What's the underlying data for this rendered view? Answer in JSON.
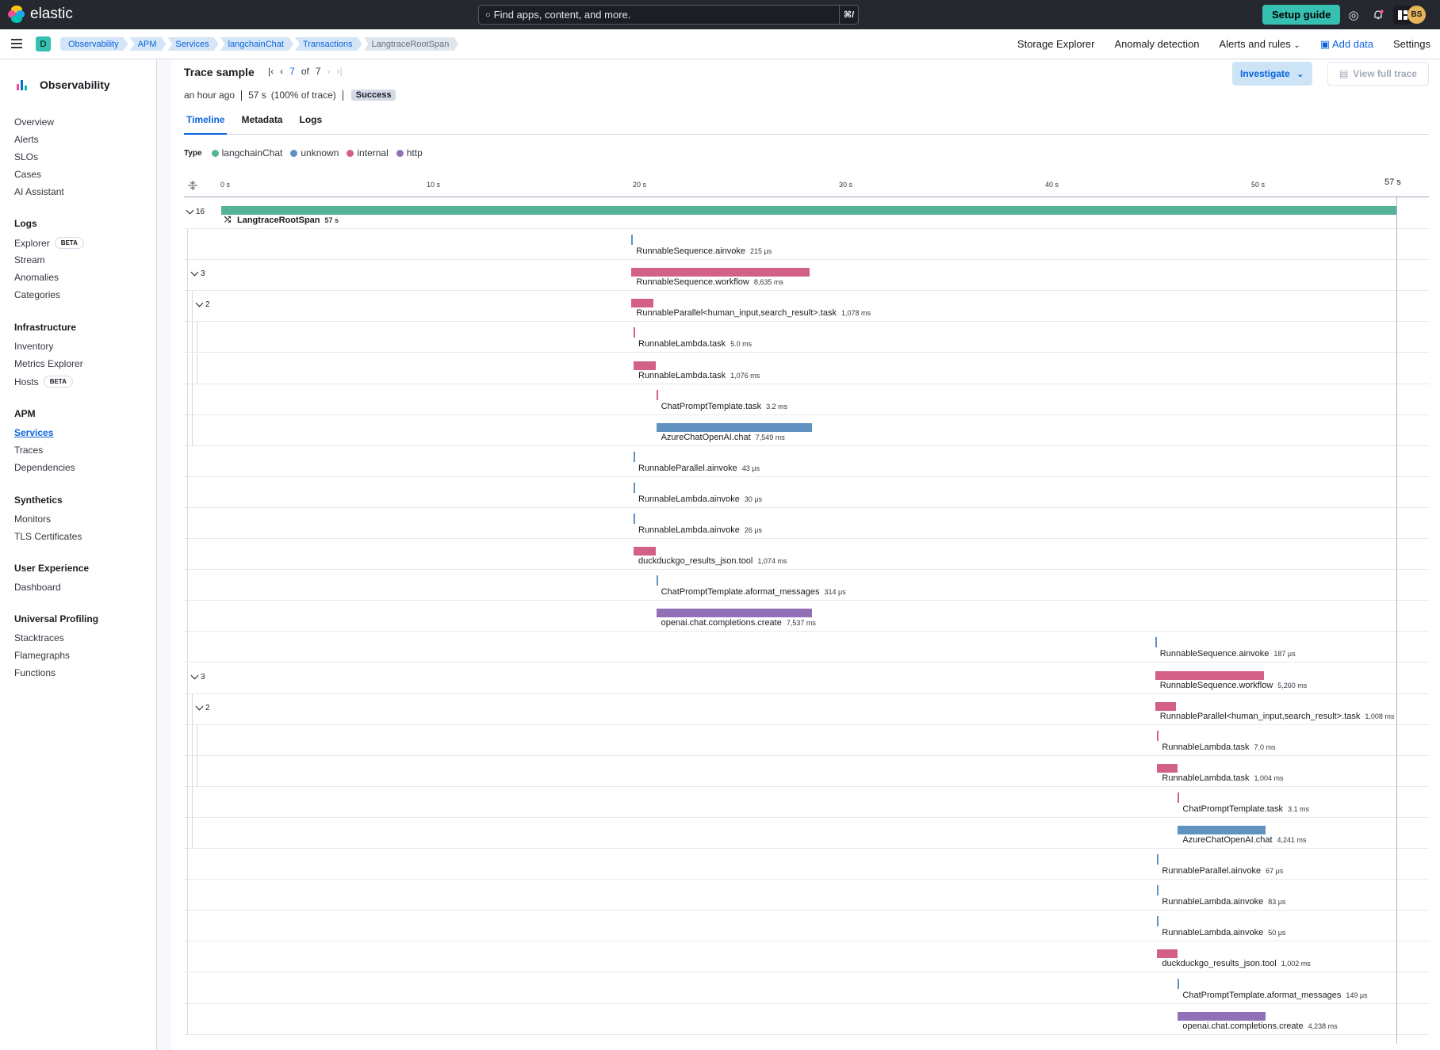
{
  "header": {
    "brand": "elastic",
    "search_placeholder": "Find apps, content, and more.",
    "search_shortcut": "⌘/",
    "setup_guide": "Setup guide",
    "avatar": "BS"
  },
  "secondary": {
    "space": "D",
    "breadcrumbs": [
      "Observability",
      "APM",
      "Services",
      "langchainChat",
      "Transactions",
      "LangtraceRootSpan"
    ],
    "links": {
      "storage": "Storage Explorer",
      "anomaly": "Anomaly detection",
      "alerts": "Alerts and rules",
      "add_data": "Add data",
      "settings": "Settings"
    }
  },
  "sidebar": {
    "title": "Observability",
    "top": [
      "Overview",
      "Alerts",
      "SLOs",
      "Cases",
      "AI Assistant"
    ],
    "logs": {
      "title": "Logs",
      "items": [
        "Explorer",
        "Stream",
        "Anomalies",
        "Categories"
      ]
    },
    "infra": {
      "title": "Infrastructure",
      "items": [
        "Inventory",
        "Metrics Explorer",
        "Hosts"
      ]
    },
    "apm": {
      "title": "APM",
      "items": [
        "Services",
        "Traces",
        "Dependencies"
      ]
    },
    "synthetics": {
      "title": "Synthetics",
      "items": [
        "Monitors",
        "TLS Certificates"
      ]
    },
    "ux": {
      "title": "User Experience",
      "items": [
        "Dashboard"
      ]
    },
    "profiling": {
      "title": "Universal Profiling",
      "items": [
        "Stacktraces",
        "Flamegraphs",
        "Functions"
      ]
    },
    "beta": "BETA"
  },
  "trace": {
    "title": "Trace sample",
    "page_current": "7",
    "page_of": "of",
    "page_total": "7",
    "time_ago": "an hour ago",
    "duration": "57 s",
    "percent": "(100% of trace)",
    "status": "Success",
    "investigate": "Investigate",
    "view_full": "View full trace",
    "tabs": [
      "Timeline",
      "Metadata",
      "Logs"
    ],
    "legend_label": "Type",
    "legend": [
      {
        "name": "langchainChat",
        "color": "#54b399"
      },
      {
        "name": "unknown",
        "color": "#6092c0"
      },
      {
        "name": "internal",
        "color": "#d36086"
      },
      {
        "name": "http",
        "color": "#9170b8"
      }
    ],
    "axis_ticks": [
      "0 s",
      "10 s",
      "20 s",
      "30 s",
      "40 s",
      "50 s"
    ],
    "axis_end": "57 s"
  },
  "spans": [
    {
      "name": "LangtraceRootSpan",
      "dur": "57 s",
      "start": 0,
      "len": 57,
      "type": "langchainChat",
      "depth": 0,
      "toggle": "16",
      "root": true
    },
    {
      "name": "RunnableSequence.ainvoke",
      "dur": "215 μs",
      "start": 19.9,
      "len": 0.000215,
      "type": "unknown",
      "depth": 1
    },
    {
      "name": "RunnableSequence.workflow",
      "dur": "8,635 ms",
      "start": 19.9,
      "len": 8.635,
      "type": "internal",
      "depth": 1,
      "toggle": "3"
    },
    {
      "name": "RunnableParallel<human_input,search_result>.task",
      "dur": "1,078 ms",
      "start": 19.9,
      "len": 1.078,
      "type": "internal",
      "depth": 2,
      "toggle": "2"
    },
    {
      "name": "RunnableLambda.task",
      "dur": "5.0 ms",
      "start": 20.0,
      "len": 0.005,
      "type": "internal",
      "depth": 3
    },
    {
      "name": "RunnableLambda.task",
      "dur": "1,076 ms",
      "start": 20.0,
      "len": 1.076,
      "type": "internal",
      "depth": 3
    },
    {
      "name": "ChatPromptTemplate.task",
      "dur": "3.2 ms",
      "start": 21.1,
      "len": 0.0032,
      "type": "internal",
      "depth": 2
    },
    {
      "name": "AzureChatOpenAI.chat",
      "dur": "7,549 ms",
      "start": 21.1,
      "len": 7.549,
      "type": "unknown",
      "depth": 2
    },
    {
      "name": "RunnableParallel.ainvoke",
      "dur": "43 μs",
      "start": 20.0,
      "len": 4.3e-05,
      "type": "unknown",
      "depth": 1
    },
    {
      "name": "RunnableLambda.ainvoke",
      "dur": "30 μs",
      "start": 20.0,
      "len": 3e-05,
      "type": "unknown",
      "depth": 1
    },
    {
      "name": "RunnableLambda.ainvoke",
      "dur": "26 μs",
      "start": 20.0,
      "len": 2.6e-05,
      "type": "unknown",
      "depth": 1
    },
    {
      "name": "duckduckgo_results_json.tool",
      "dur": "1,074 ms",
      "start": 20.0,
      "len": 1.074,
      "type": "internal",
      "depth": 1
    },
    {
      "name": "ChatPromptTemplate.aformat_messages",
      "dur": "314 μs",
      "start": 21.1,
      "len": 0.000314,
      "type": "unknown",
      "depth": 1
    },
    {
      "name": "openai.chat.completions.create",
      "dur": "7,537 ms",
      "start": 21.1,
      "len": 7.537,
      "type": "http",
      "depth": 1
    },
    {
      "name": "RunnableSequence.ainvoke",
      "dur": "187 μs",
      "start": 45.3,
      "len": 0.000187,
      "type": "unknown",
      "depth": 1
    },
    {
      "name": "RunnableSequence.workflow",
      "dur": "5,260 ms",
      "start": 45.3,
      "len": 5.26,
      "type": "internal",
      "depth": 1,
      "toggle": "3"
    },
    {
      "name": "RunnableParallel<human_input,search_result>.task",
      "dur": "1,008 ms",
      "start": 45.3,
      "len": 1.008,
      "type": "internal",
      "depth": 2,
      "toggle": "2"
    },
    {
      "name": "RunnableLambda.task",
      "dur": "7.0 ms",
      "start": 45.4,
      "len": 0.007,
      "type": "internal",
      "depth": 3
    },
    {
      "name": "RunnableLambda.task",
      "dur": "1,004 ms",
      "start": 45.4,
      "len": 1.004,
      "type": "internal",
      "depth": 3
    },
    {
      "name": "ChatPromptTemplate.task",
      "dur": "3.1 ms",
      "start": 46.4,
      "len": 0.0031,
      "type": "internal",
      "depth": 2
    },
    {
      "name": "AzureChatOpenAI.chat",
      "dur": "4,241 ms",
      "start": 46.4,
      "len": 4.241,
      "type": "unknown",
      "depth": 2
    },
    {
      "name": "RunnableParallel.ainvoke",
      "dur": "67 μs",
      "start": 45.4,
      "len": 6.7e-05,
      "type": "unknown",
      "depth": 1
    },
    {
      "name": "RunnableLambda.ainvoke",
      "dur": "83 μs",
      "start": 45.4,
      "len": 8.3e-05,
      "type": "unknown",
      "depth": 1
    },
    {
      "name": "RunnableLambda.ainvoke",
      "dur": "50 μs",
      "start": 45.4,
      "len": 5e-05,
      "type": "unknown",
      "depth": 1
    },
    {
      "name": "duckduckgo_results_json.tool",
      "dur": "1,002 ms",
      "start": 45.4,
      "len": 1.002,
      "type": "internal",
      "depth": 1
    },
    {
      "name": "ChatPromptTemplate.aformat_messages",
      "dur": "149 μs",
      "start": 46.4,
      "len": 0.000149,
      "type": "unknown",
      "depth": 1
    },
    {
      "name": "openai.chat.completions.create",
      "dur": "4,238 ms",
      "start": 46.4,
      "len": 4.238,
      "type": "http",
      "depth": 1
    }
  ]
}
